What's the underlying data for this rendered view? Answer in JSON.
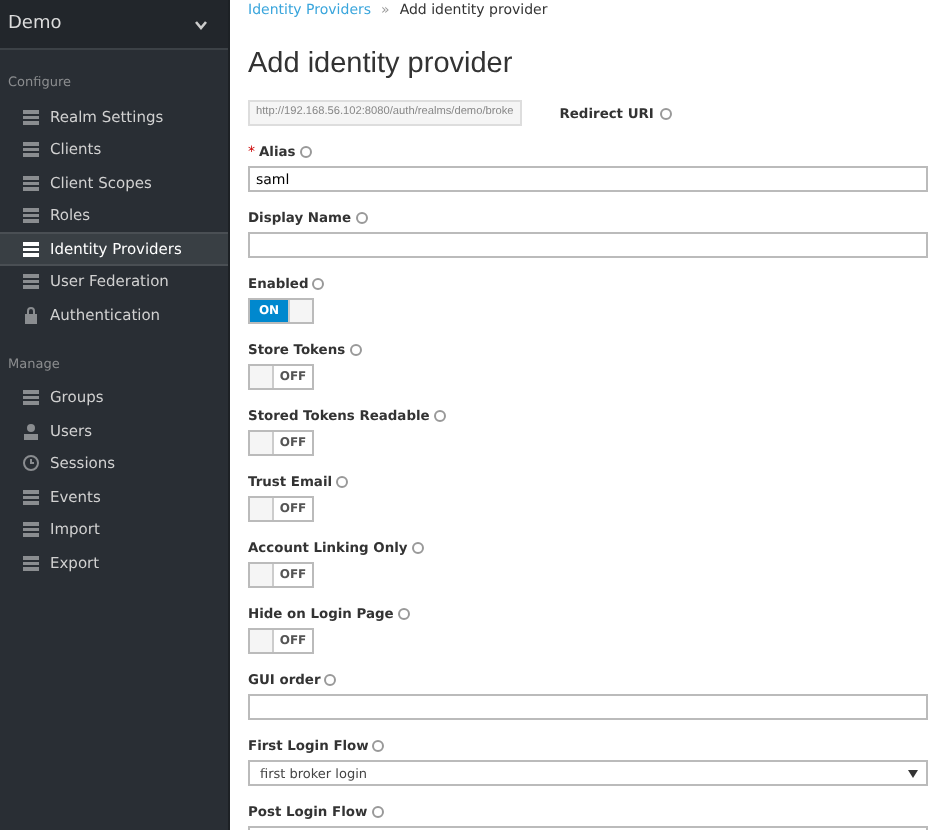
{
  "sidebar": {
    "realm": "Demo",
    "sections": [
      {
        "heading": "Configure",
        "items": [
          {
            "label": "Realm Settings",
            "selected": false
          },
          {
            "label": "Clients",
            "selected": false
          },
          {
            "label": "Client Scopes",
            "selected": false
          },
          {
            "label": "Roles",
            "selected": false
          },
          {
            "label": "Identity Providers",
            "selected": true
          },
          {
            "label": "User Federation",
            "selected": false
          },
          {
            "label": "Authentication",
            "selected": false
          }
        ]
      },
      {
        "heading": "Manage",
        "items": [
          {
            "label": "Groups",
            "selected": false
          },
          {
            "label": "Users",
            "selected": false
          },
          {
            "label": "Sessions",
            "selected": false
          },
          {
            "label": "Events",
            "selected": false
          },
          {
            "label": "Import",
            "selected": false
          },
          {
            "label": "Export",
            "selected": false
          }
        ]
      }
    ]
  },
  "breadcrumb": [
    {
      "label": "Identity Providers",
      "kind": "link"
    },
    {
      "label": "»",
      "kind": "separator"
    },
    {
      "label": "Add identity provider",
      "kind": "current"
    }
  ],
  "title": "Add identity provider",
  "redirect": {
    "value": "http://192.168.56.102:8080/auth/realms/demo/broke",
    "label": "Redirect URI"
  },
  "fields": [
    {
      "kind": "text",
      "label": "Alias",
      "required_mark": "*",
      "value": "saml"
    },
    {
      "kind": "text",
      "label": "Display Name"
    },
    {
      "kind": "toggle",
      "label": "Enabled",
      "on": true,
      "text": "ON"
    },
    {
      "kind": "toggle",
      "label": "Store Tokens",
      "on": false,
      "text": "OFF"
    },
    {
      "kind": "toggle",
      "label": "Stored Tokens Readable",
      "on": false,
      "text": "OFF"
    },
    {
      "kind": "toggle",
      "label": "Trust Email",
      "on": false,
      "text": "OFF"
    },
    {
      "kind": "toggle",
      "label": "Account Linking Only",
      "on": false,
      "text": "OFF"
    },
    {
      "kind": "toggle",
      "label": "Hide on Login Page",
      "on": false,
      "text": "OFF"
    },
    {
      "kind": "text",
      "label": "GUI order"
    },
    {
      "kind": "select",
      "label": "First Login Flow",
      "value": "first broker login"
    },
    {
      "kind": "select",
      "label": "Post Login Flow"
    }
  ]
}
